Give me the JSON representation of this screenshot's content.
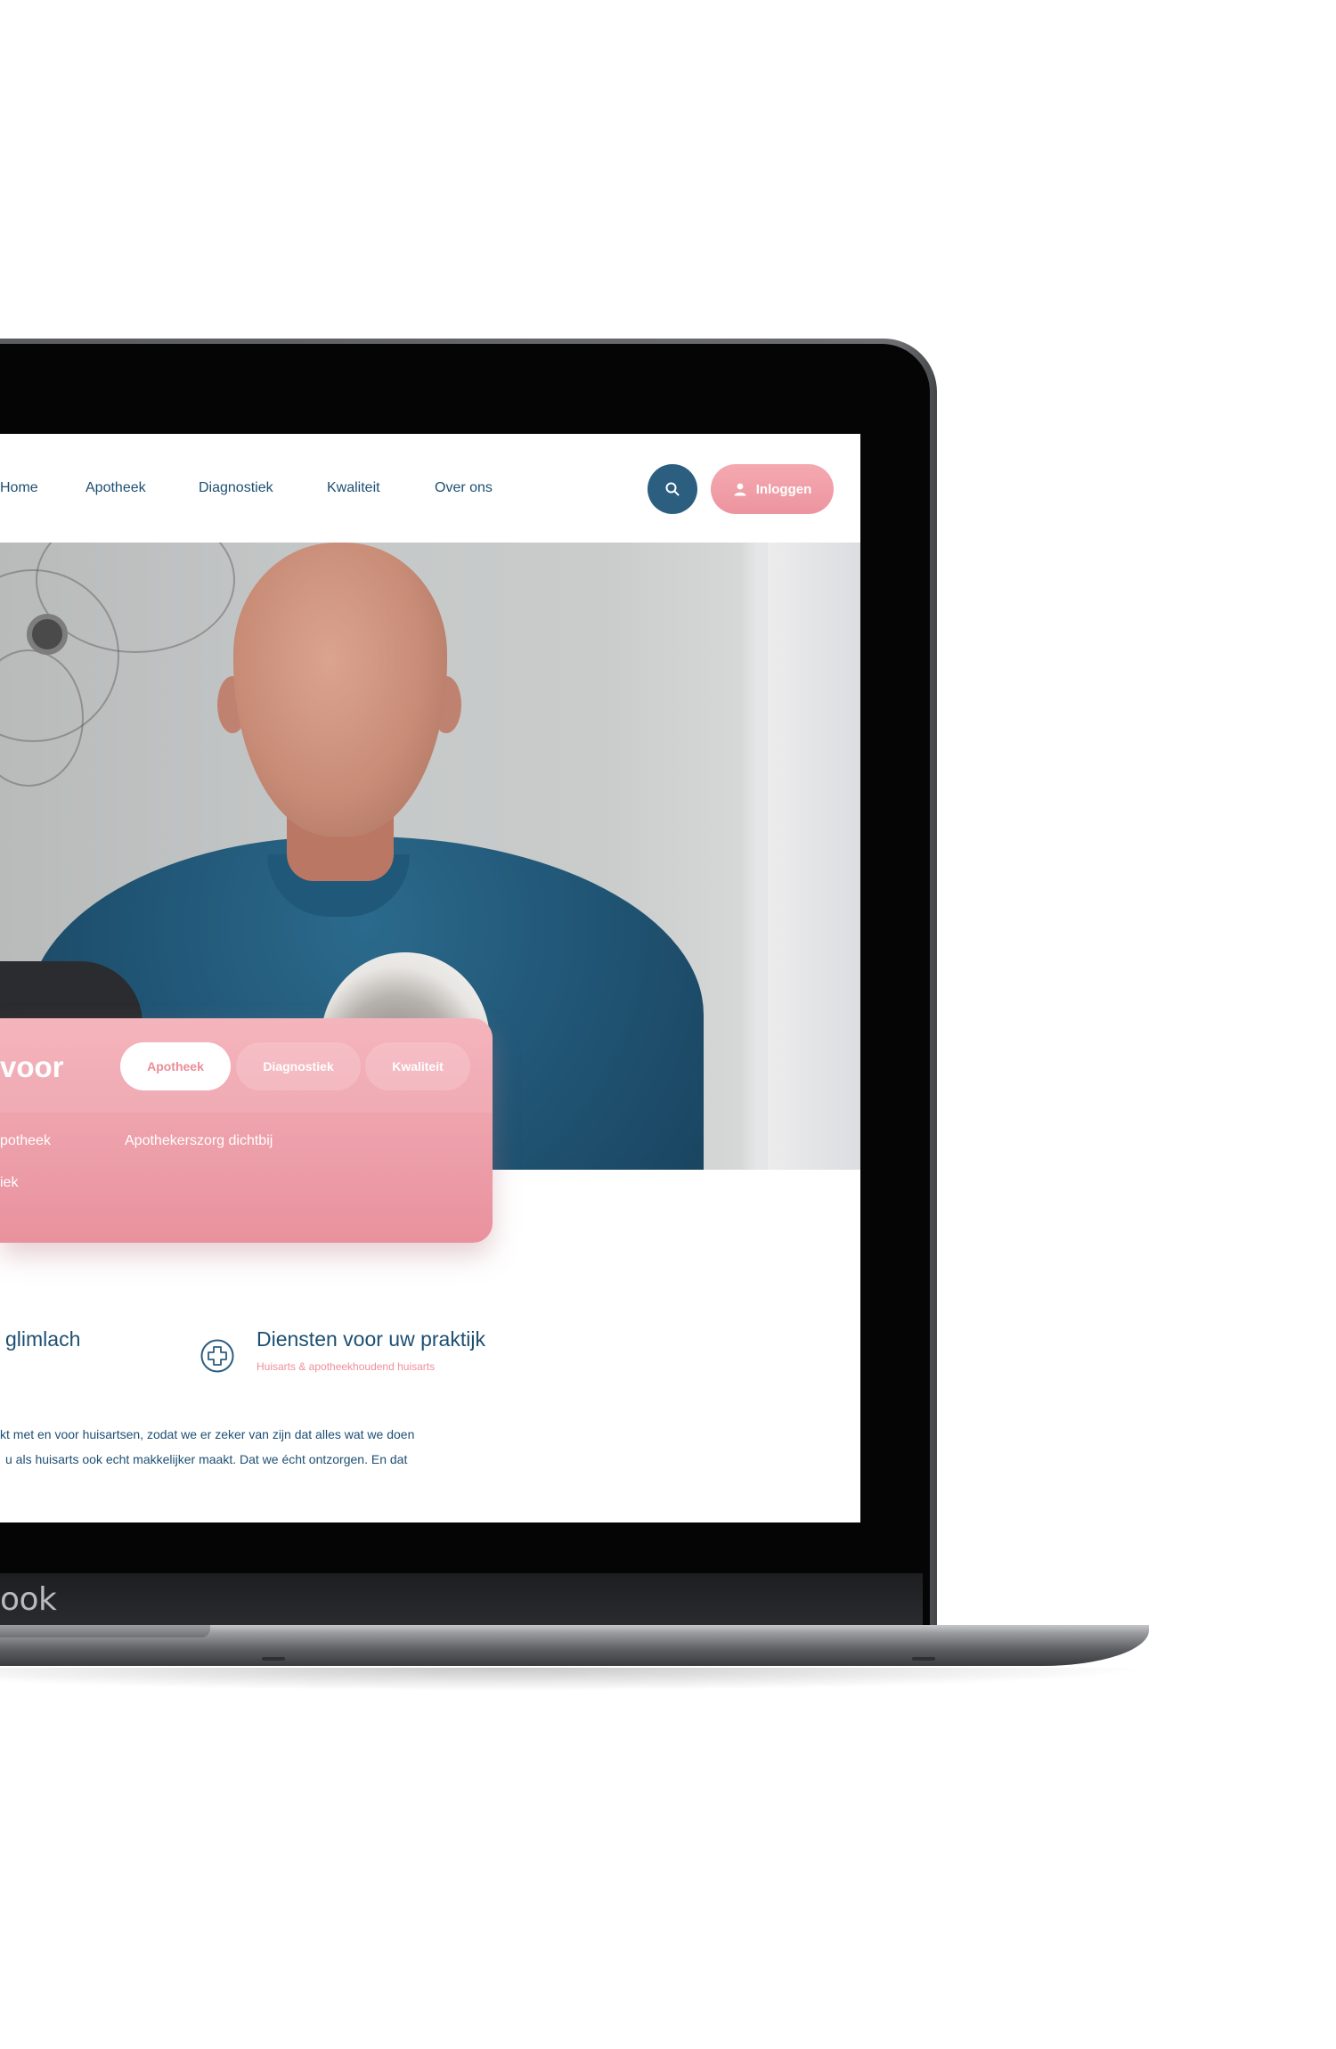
{
  "laptop": {
    "brand": "ook"
  },
  "nav": {
    "items": [
      {
        "label": "Home"
      },
      {
        "label": "Apotheek"
      },
      {
        "label": "Diagnostiek"
      },
      {
        "label": "Kwaliteit"
      },
      {
        "label": "Over ons"
      }
    ],
    "search_icon": "search-icon",
    "login_label": "Inloggen",
    "login_icon": "user-icon"
  },
  "card": {
    "title": "voor",
    "tabs": [
      {
        "label": "Apotheek",
        "active": true
      },
      {
        "label": "Diagnostiek",
        "active": false
      },
      {
        "label": "Kwaliteit",
        "active": false
      }
    ],
    "links": [
      {
        "label": "potheek"
      },
      {
        "label": "Apothekerszorg dichtbij"
      },
      {
        "label": "iek"
      }
    ]
  },
  "features": [
    {
      "title": "glimlach",
      "subtitle": ""
    },
    {
      "title": "Diensten voor uw praktijk",
      "subtitle": "Huisarts & apotheekhoudend huisarts",
      "icon": "plus-circle-icon"
    }
  ],
  "body": {
    "lines": [
      "kt met en voor huisartsen, zodat we er zeker van zijn dat alles wat we doen",
      "u als huisarts ook echt makkelijker maakt. Dat we écht ontzorgen. En dat"
    ]
  },
  "colors": {
    "navy": "#1d4f72",
    "pink": "#ef8f9c",
    "search_button": "#2c5e80"
  }
}
